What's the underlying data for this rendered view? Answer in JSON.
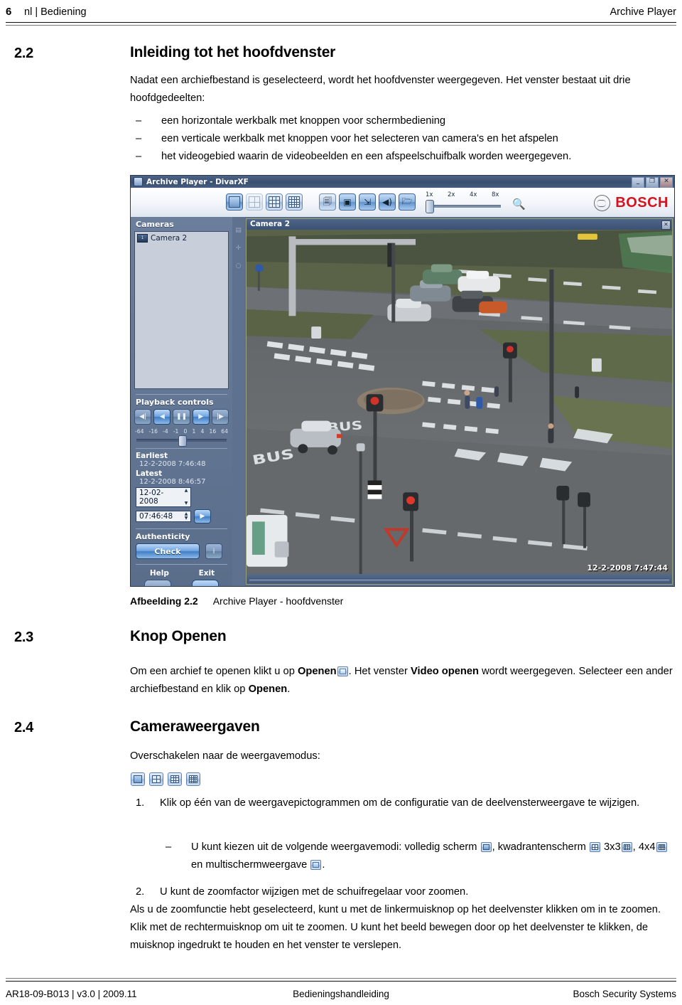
{
  "header": {
    "page_number": "6",
    "left": "nl | Bediening",
    "right": "Archive Player"
  },
  "sections": [
    {
      "number": "2.2",
      "title": "Inleiding tot het hoofdvenster",
      "intro": "Nadat een archiefbestand is geselecteerd, wordt het hoofdvenster weergegeven. Het venster bestaat uit drie hoofdgedeelten:",
      "bullets": [
        "een horizontale werkbalk met knoppen voor schermbediening",
        "een verticale werkbalk met knoppen voor het selecteren van camera's en het afspelen",
        "het videogebied waarin de videobeelden en een afspeelschuifbalk worden weergegeven."
      ],
      "dash": "–"
    },
    {
      "number": "2.3",
      "title": "Knop Openen",
      "text_1": "Om een archief te openen klikt u op ",
      "bold_1": "Openen",
      "text_2": ". Het venster ",
      "bold_2": "Video openen",
      "text_3": " wordt weergegeven. Selecteer een ander archiefbestand en klik op ",
      "bold_3": "Openen",
      "text_4": "."
    },
    {
      "number": "2.4",
      "title": "Cameraweergaven",
      "intro": "Overschakelen naar de weergavemodus:",
      "step_1_num": "1.",
      "step_1": "Klik op één van de weergavepictogrammen om de configuratie van de deelvensterweergave te wijzigen.",
      "sub_dash": "–",
      "sub_1a": "U kunt kiezen uit de volgende weergavemodi: volledig scherm ",
      "sub_1b": ", kwadrantenscherm ",
      "sub_1c": " 3x3",
      "sub_1d": ", 4x4",
      "sub_1e": " en multischermweergave ",
      "sub_1f": ".",
      "step_2_num": "2.",
      "step_2": "U kunt de zoomfactor wijzigen met de schuifregelaar voor zoomen.",
      "tail": "Als u de zoomfunctie hebt geselecteerd, kunt u met de linkermuisknop op het deelvenster klikken om in te zoomen. Klik met de rechtermuisknop om uit te zoomen. U kunt het beeld bewegen door op het deelvenster te klikken, de muisknop ingedrukt te houden en het venster te verslepen."
    }
  ],
  "figure": {
    "label": "Afbeelding 2.2",
    "caption": "Archive Player - hoofdvenster"
  },
  "app": {
    "title": "Archive Player - DivarXF",
    "window_buttons": {
      "minimize": "_",
      "maximize": "❐",
      "close": "✕"
    },
    "toolbar": {
      "view_buttons": [
        {
          "name": "single-view",
          "label": "1x1",
          "state": "selected"
        },
        {
          "name": "quad-view",
          "label": "2x2",
          "state": "disabled"
        },
        {
          "name": "3x3-view",
          "label": "3x3",
          "state": "normal"
        },
        {
          "name": "4x4-view",
          "label": "4x4",
          "state": "normal"
        }
      ],
      "action_buttons": [
        {
          "name": "authenticity",
          "glyph": "🗐"
        },
        {
          "name": "snapshot",
          "glyph": "▣"
        },
        {
          "name": "export",
          "glyph": "⇲"
        },
        {
          "name": "audio",
          "glyph": "◀)"
        },
        {
          "name": "open-file",
          "glyph": "🗁"
        }
      ],
      "zoom_ticks": [
        "1x",
        "2x",
        "4x",
        "8x"
      ],
      "zoom_value": "1x"
    },
    "brand": "BOSCH",
    "sidebar": {
      "cameras_title": "Cameras",
      "camera_items": [
        {
          "index": "1",
          "label": "Camera 2"
        }
      ],
      "playback_title": "Playback controls",
      "playback_buttons": [
        {
          "name": "step-back",
          "glyph": "◀|"
        },
        {
          "name": "reverse-play",
          "glyph": "◀"
        },
        {
          "name": "pause",
          "glyph": "❚❚"
        },
        {
          "name": "play",
          "glyph": "▶"
        },
        {
          "name": "step-forward",
          "glyph": "|▶"
        }
      ],
      "speed_scale": [
        "-64",
        "-16",
        "-4",
        "-1",
        "0",
        "1",
        "4",
        "16",
        "64"
      ],
      "earliest_label": "Earliest",
      "earliest_value": "12-2-2008 7:46:48",
      "latest_label": "Latest",
      "latest_value": "12-2-2008 8:46:57",
      "date_value": "12-02-2008",
      "time_value": "07:46:48",
      "goto_glyph": "▶",
      "authenticity_title": "Authenticity",
      "check_label": "Check",
      "info_glyph": "i",
      "help_label": "Help",
      "exit_label": "Exit",
      "help_glyph": "?",
      "exit_glyph": "⇥"
    },
    "video": {
      "pane_title": "Camera 2",
      "close_glyph": "✕",
      "timestamp": "12-2-2008 7:47:44"
    }
  },
  "footer": {
    "left": "AR18-09-B013 | v3.0 | 2009.11",
    "center": "Bedieningshandleiding",
    "right": "Bosch Security Systems"
  },
  "colors": {
    "brand_red": "#d7121f",
    "app_chrome": "#5b6f8c",
    "accent_blue": "#3f7ec4"
  }
}
